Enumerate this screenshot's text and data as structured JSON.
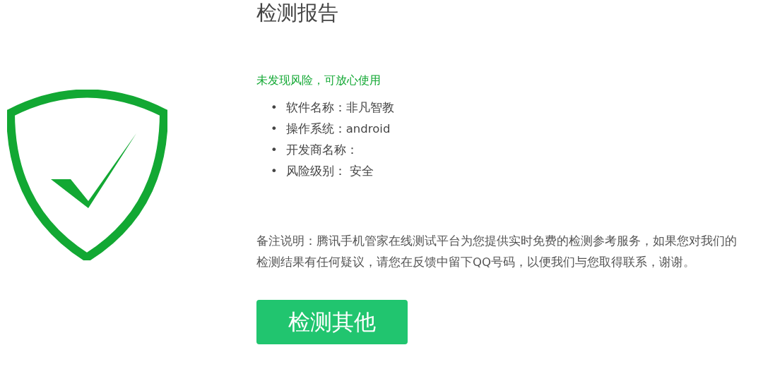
{
  "title": "检测报告",
  "status": {
    "text": "未发现风险，可放心使用",
    "safe": true
  },
  "details": [
    {
      "bullet": "•",
      "text": "软件名称：非凡智教"
    },
    {
      "bullet": "•",
      "text": "操作系统：android"
    },
    {
      "bullet": "•",
      "text": "开发商名称："
    },
    {
      "bullet": "•",
      "text": "风险级别： 安全"
    }
  ],
  "note": "备注说明：腾讯手机管家在线测试平台为您提供实时免费的检测参考服务，如果您对我们的检测结果有任何疑议，请您在反馈中留下QQ号码，以便我们与您取得联系，谢谢。",
  "button": "检测其他"
}
